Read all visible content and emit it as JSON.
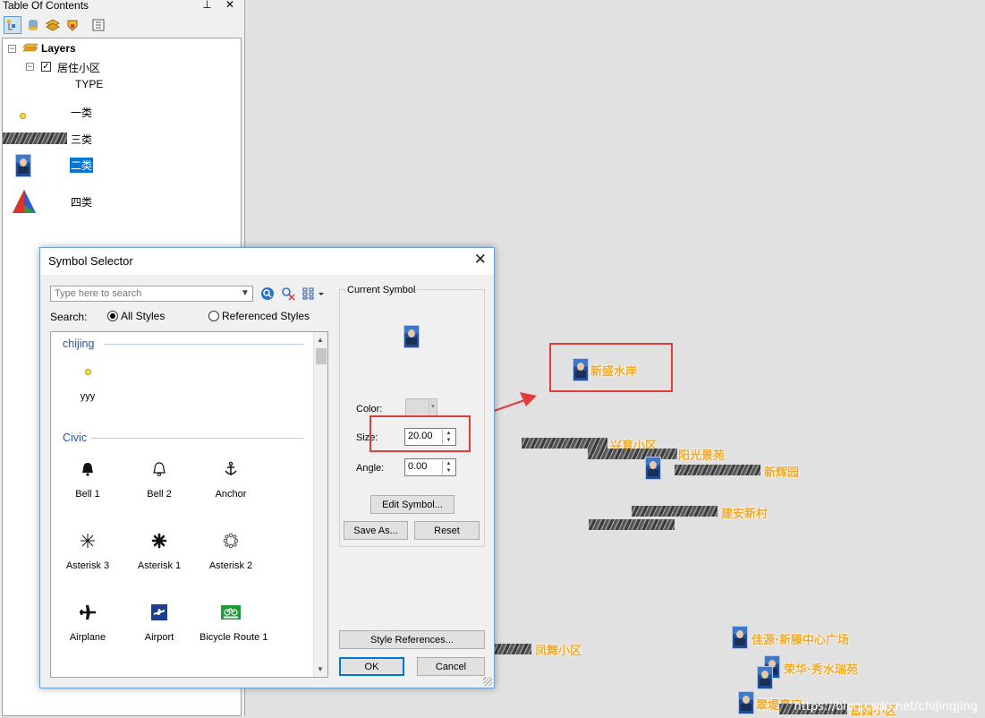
{
  "toc": {
    "title": "Table Of Contents",
    "title_buttons": "⊥ ✕",
    "toolbar": [
      {
        "name": "list-by-drawing-order-icon"
      },
      {
        "name": "list-by-source-icon"
      },
      {
        "name": "list-by-visibility-icon"
      },
      {
        "name": "list-by-selection-icon"
      },
      {
        "name": "options-icon"
      }
    ],
    "tree": {
      "root_label": "Layers",
      "layer_label": "居住小区",
      "field_label": "TYPE",
      "classes": [
        {
          "label": "一类",
          "symbol": "yellow-dot-icon"
        },
        {
          "label": "三类",
          "symbol": "raster-strip-icon"
        },
        {
          "label": "二类",
          "symbol": "photo-marker-icon",
          "selected": true
        },
        {
          "label": "四类",
          "symbol": "triangle-icon"
        }
      ]
    }
  },
  "dialog": {
    "title": "Symbol Selector",
    "close": "✕",
    "search_placeholder": "Type here to search",
    "search_label": "Search:",
    "radio_all": "All Styles",
    "radio_referenced": "Referenced Styles",
    "categories": [
      {
        "name": "chijing",
        "symbols": [
          {
            "label": "yyy",
            "icon": "yellow-dot-icon"
          }
        ]
      },
      {
        "name": "Civic",
        "symbols": [
          {
            "label": "Bell 1",
            "icon": "bell-filled-icon"
          },
          {
            "label": "Bell 2",
            "icon": "bell-outline-icon"
          },
          {
            "label": "Anchor",
            "icon": "anchor-icon"
          },
          {
            "label": "Asterisk 3",
            "icon": "asterisk-thin-icon"
          },
          {
            "label": "Asterisk 1",
            "icon": "asterisk-bold-icon"
          },
          {
            "label": "Asterisk 2",
            "icon": "asterisk-dotted-icon"
          },
          {
            "label": "Airplane",
            "icon": "airplane-icon"
          },
          {
            "label": "Airport",
            "icon": "airport-icon"
          },
          {
            "label": "Bicycle Route 1",
            "icon": "bicycle-route-icon"
          }
        ]
      }
    ],
    "current_symbol_label": "Current Symbol",
    "color_label": "Color:",
    "size_label": "Size:",
    "size_value": "20.00",
    "angle_label": "Angle:",
    "angle_value": "0.00",
    "edit_symbol": "Edit Symbol...",
    "save_as": "Save As...",
    "reset": "Reset",
    "style_references": "Style References...",
    "ok": "OK",
    "cancel": "Cancel"
  },
  "map": {
    "labels": [
      "新盛水岸",
      "兴育小区",
      "阳光景苑",
      "新辉园",
      "建安新村",
      "凤舞小区",
      "佳源·新滕中心广场",
      "荣华·秀水瑞苑",
      "翠堤豪府",
      "富园小区"
    ],
    "watermark": "https://blog.csdn.net/chijingjing",
    "highlight_color": "#e23b3b",
    "label_color": "#f0a928"
  }
}
